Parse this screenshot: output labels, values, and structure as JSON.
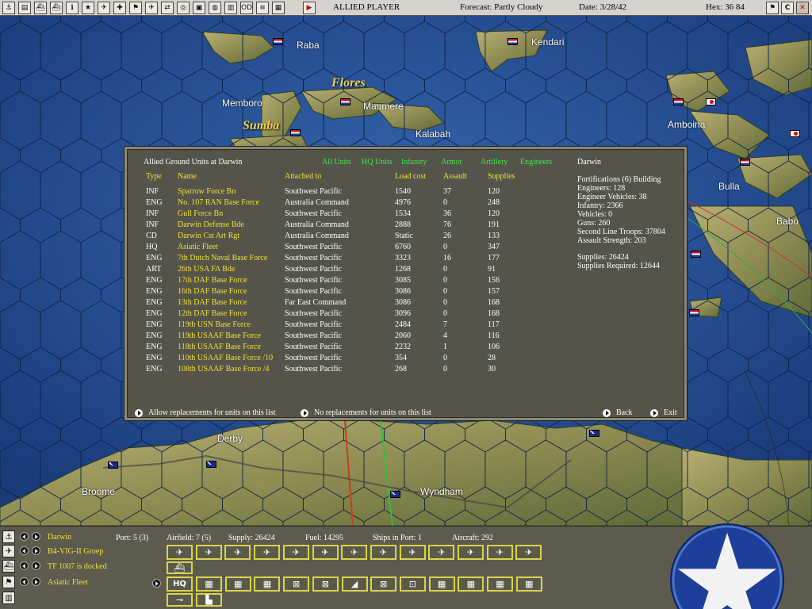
{
  "topbar": {
    "player": "ALLIED PLAYER",
    "forecast": "Forecast: Partly Cloudy",
    "date": "Date: 3/28/42",
    "hex": "Hex: 36 84",
    "close_label": "C",
    "buttons": [
      "anchor-icon",
      "document-icon",
      "ship-icon",
      "ship2-icon",
      "info-icon",
      "star-icon",
      "plane-icon",
      "bomb-icon",
      "flag-icon",
      "plane-land-icon",
      "route-icon",
      "target-icon",
      "infantry-icon",
      "globe-icon",
      "book-icon",
      "od-icon",
      "list-icon",
      "map-icon",
      "play-icon"
    ]
  },
  "map": {
    "places": [
      {
        "name": "Raba",
        "big": false
      },
      {
        "name": "Kendari",
        "big": false
      },
      {
        "name": "Flores",
        "big": true
      },
      {
        "name": "Memboro",
        "big": false
      },
      {
        "name": "Maumere",
        "big": false
      },
      {
        "name": "Sumba",
        "big": true
      },
      {
        "name": "Kalabah",
        "big": false
      },
      {
        "name": "Amboina",
        "big": false
      },
      {
        "name": "Bulla",
        "big": false
      },
      {
        "name": "Babo",
        "big": false
      },
      {
        "name": "Derby",
        "big": false
      },
      {
        "name": "Broome",
        "big": false
      },
      {
        "name": "Wyndham",
        "big": false
      }
    ]
  },
  "dialog": {
    "title": "Allied Ground Units at Darwin",
    "filters": [
      "All Units",
      "HQ Units",
      "Infantry",
      "Armor",
      "Artillery",
      "Engineers"
    ],
    "location": "Darwin",
    "headers": {
      "type": "Type",
      "name": "Name",
      "attached": "Attached to",
      "load": "Load cost",
      "assault": "Assault",
      "supplies": "Supplies"
    },
    "units": [
      {
        "type": "INF",
        "name": "Sparrow Force Bn",
        "attached": "Southwest Pacific",
        "load": "1540",
        "assault": "37",
        "supplies": "120"
      },
      {
        "type": "ENG",
        "name": "No. 107 RAN Base Force",
        "attached": "Australia Command",
        "load": "4976",
        "assault": "0",
        "supplies": "248"
      },
      {
        "type": "INF",
        "name": "Gull Force Bn",
        "attached": "Southwest Pacific",
        "load": "1534",
        "assault": "36",
        "supplies": "120"
      },
      {
        "type": "INF",
        "name": "Darwin Defense Bde",
        "attached": "Australia Command",
        "load": "2888",
        "assault": "76",
        "supplies": "191"
      },
      {
        "type": "CD",
        "name": "Darwin Cst Art Rgt",
        "attached": "Australia Command",
        "load": "Static",
        "assault": "26",
        "supplies": "133"
      },
      {
        "type": "HQ",
        "name": "Asiatic Fleet",
        "attached": "Southwest Pacific",
        "load": "6760",
        "assault": "0",
        "supplies": "347"
      },
      {
        "type": "ENG",
        "name": "7th Dutch Naval Base Force",
        "attached": "Southwest Pacific",
        "load": "3323",
        "assault": "16",
        "supplies": "177"
      },
      {
        "type": "ART",
        "name": "26th USA FA Bde",
        "attached": "Southwest Pacific",
        "load": "1268",
        "assault": "0",
        "supplies": "91"
      },
      {
        "type": "ENG",
        "name": "17th DAF Base Force",
        "attached": "Southwest Pacific",
        "load": "3085",
        "assault": "0",
        "supplies": "156"
      },
      {
        "type": "ENG",
        "name": "16th DAF Base Force",
        "attached": "Southwest Pacific",
        "load": "3086",
        "assault": "0",
        "supplies": "157"
      },
      {
        "type": "ENG",
        "name": "13th DAF Base Force",
        "attached": "Far East Command",
        "load": "3086",
        "assault": "0",
        "supplies": "168"
      },
      {
        "type": "ENG",
        "name": "12th DAF Base Force",
        "attached": "Southwest Pacific",
        "load": "3096",
        "assault": "0",
        "supplies": "168"
      },
      {
        "type": "ENG",
        "name": "119th USN Base Force",
        "attached": "Southwest Pacific",
        "load": "2484",
        "assault": "7",
        "supplies": "117"
      },
      {
        "type": "ENG",
        "name": "119th USAAF Base Force",
        "attached": "Southwest Pacific",
        "load": "2060",
        "assault": "4",
        "supplies": "116"
      },
      {
        "type": "ENG",
        "name": "118th USAAF Base Force",
        "attached": "Southwest Pacific",
        "load": "2232",
        "assault": "1",
        "supplies": "106"
      },
      {
        "type": "ENG",
        "name": "110th USAAF Base Force /10",
        "attached": "Southwest Pacific",
        "load": "354",
        "assault": "0",
        "supplies": "28"
      },
      {
        "type": "ENG",
        "name": "108th USAAF Base Force /4",
        "attached": "Southwest Pacific",
        "load": "268",
        "assault": "0",
        "supplies": "30"
      }
    ],
    "stats": [
      "Fortifications (6) Building",
      "Engineers: 128",
      "Engineer Vehicles: 38",
      "Infantry: 2366",
      "Vehicles: 0",
      "Guns: 260",
      "Second Line Troops: 37804",
      "Assault Strength: 203"
    ],
    "supplies": "Supplies: 26424",
    "supplies_required": "Supplies Required: 12644",
    "btn_allow": "Allow replacements for units on this list",
    "btn_no": "No replacements for units on this list",
    "btn_back": "Back",
    "btn_exit": "Exit"
  },
  "bottom": {
    "base": "Darwin",
    "port": "Port: 5 (3)",
    "airfield": "Airfield: 7 (5)",
    "supply": "Supply: 26424",
    "fuel": "Fuel: 14295",
    "ships": "Ships in Port: 1",
    "aircraft": "Aircraft: 292",
    "air_group": "B4-VIG-II Groep",
    "task_force": "TF 1007 is docked",
    "hq": "Asiatic Fleet",
    "hq_tile": "HQ"
  }
}
